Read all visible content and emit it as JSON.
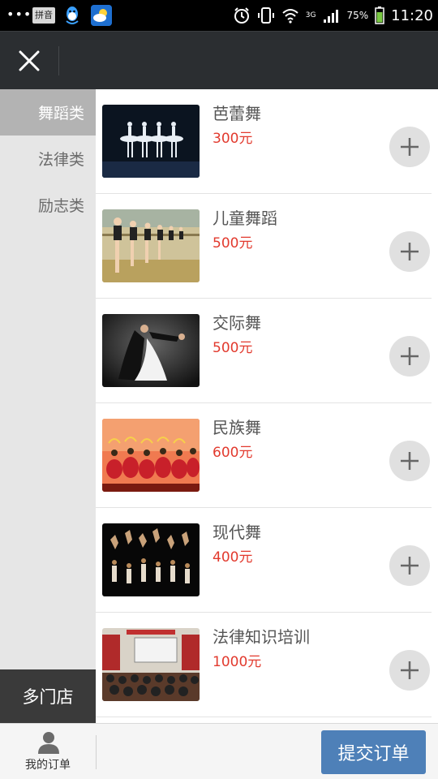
{
  "status_bar": {
    "input_method": "拼音",
    "network": "3G",
    "battery": "75%",
    "time": "11:20"
  },
  "sidebar": {
    "categories": [
      {
        "label": "舞蹈类",
        "active": true
      },
      {
        "label": "法律类",
        "active": false
      },
      {
        "label": "励志类",
        "active": false
      }
    ],
    "store_button": "多门店"
  },
  "products": [
    {
      "name": "芭蕾舞",
      "price": "300元"
    },
    {
      "name": "儿童舞蹈",
      "price": "500元"
    },
    {
      "name": "交际舞",
      "price": "500元"
    },
    {
      "name": "民族舞",
      "price": "600元"
    },
    {
      "name": "现代舞",
      "price": "400元"
    },
    {
      "name": "法律知识培训",
      "price": "1000元"
    }
  ],
  "bottom_bar": {
    "my_orders_label": "我的订单",
    "submit_label": "提交订单"
  },
  "colors": {
    "header_bg": "#2b2e31",
    "price": "#e23a2e",
    "submit_button": "#4e80b8",
    "sidebar_active": "#b3b3b3"
  },
  "icons": {
    "close": "close-icon",
    "add": "plus-icon",
    "my_orders": "user-icon"
  }
}
